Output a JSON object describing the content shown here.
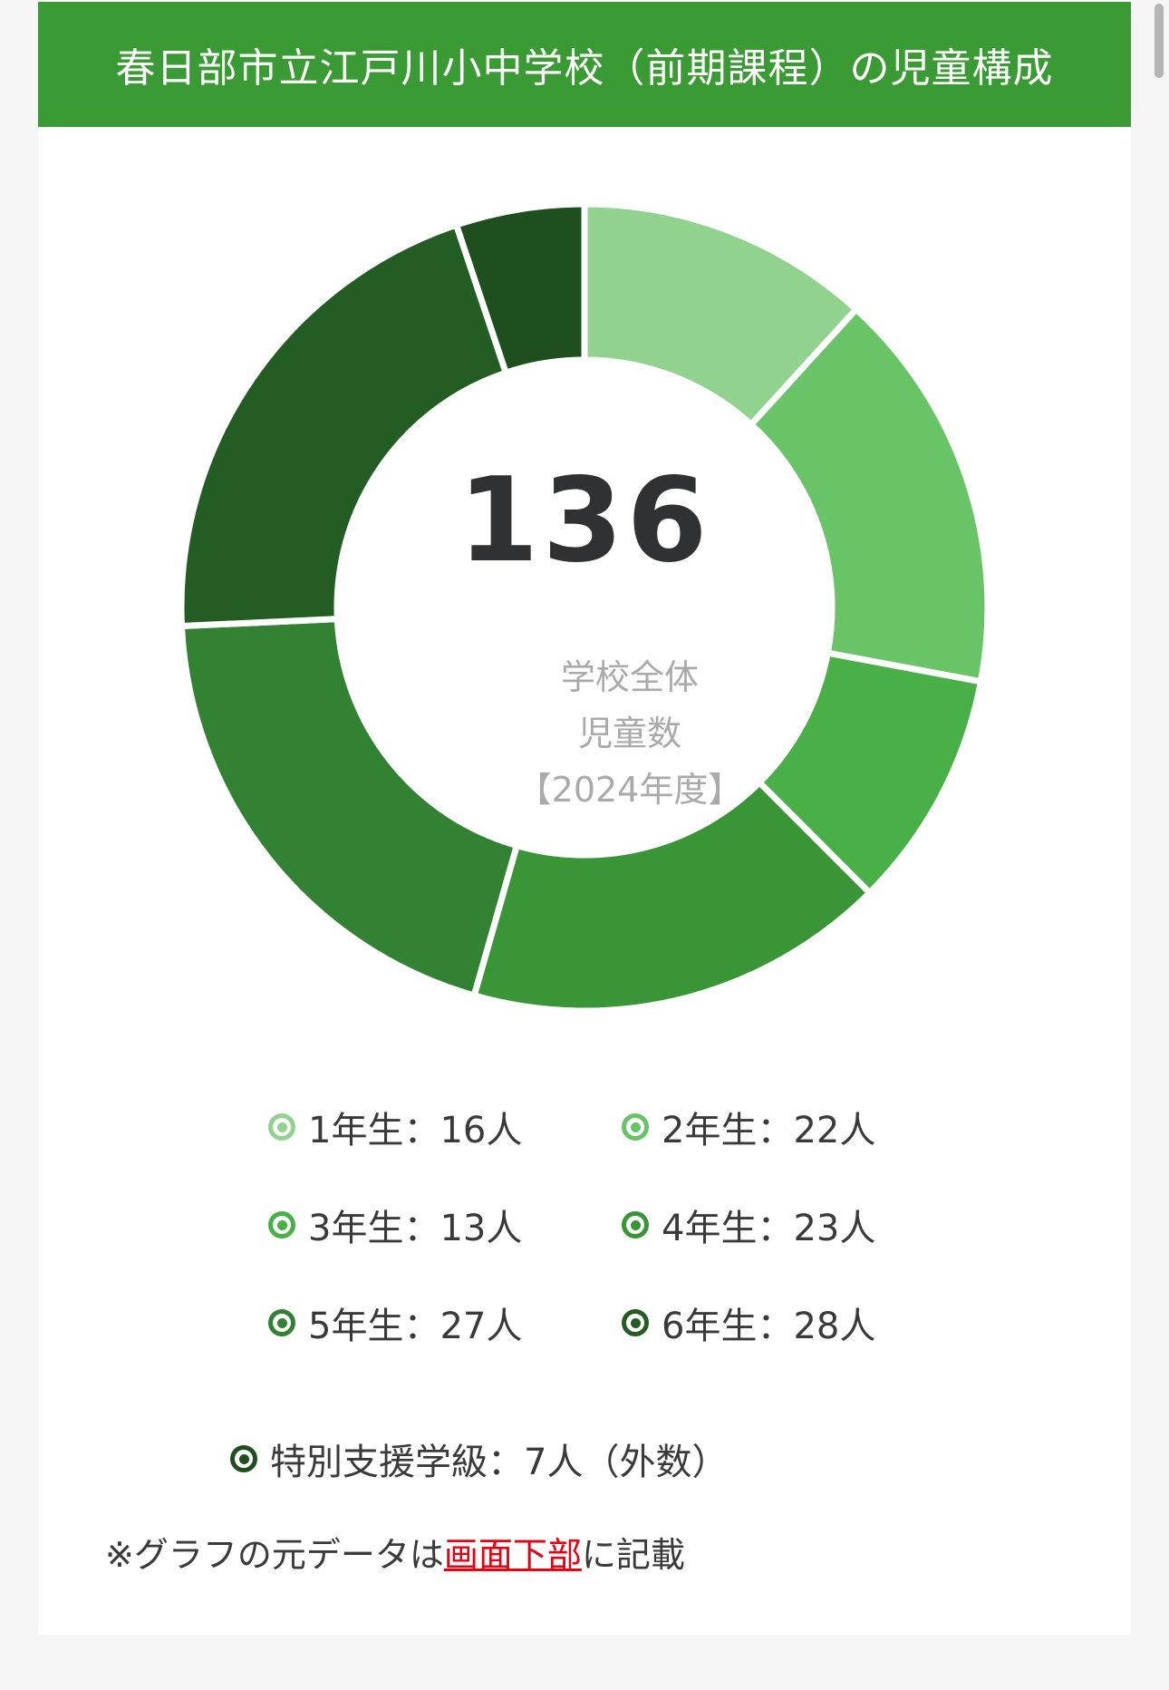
{
  "header": {
    "title": "春日部市立江戸川小中学校（前期課程）の児童構成"
  },
  "chart_data": {
    "type": "pie",
    "donut": true,
    "total": 136,
    "center_labels": [
      "学校全体",
      "児童数",
      "【2024年度】"
    ],
    "categories": [
      "1年生",
      "2年生",
      "3年生",
      "4年生",
      "5年生",
      "6年生",
      "特別支援学級"
    ],
    "values": [
      16,
      22,
      13,
      23,
      27,
      28,
      7
    ],
    "colors": [
      "#90d28e",
      "#68c466",
      "#48b046",
      "#3a9537",
      "#338234",
      "#245d23",
      "#1f4f1f"
    ]
  },
  "legend": [
    {
      "label": "1年生：16人",
      "color": "#90d28e"
    },
    {
      "label": "2年生：22人",
      "color": "#68c466"
    },
    {
      "label": "3年生：13人",
      "color": "#48b046"
    },
    {
      "label": "4年生：23人",
      "color": "#3a9537"
    },
    {
      "label": "5年生：27人",
      "color": "#338234"
    },
    {
      "label": "6年生：28人",
      "color": "#245d23"
    },
    {
      "label": "特別支援学級：7人（外数）",
      "color": "#1f4f1f"
    }
  ],
  "note": {
    "prefix": "※グラフの元データは",
    "link": "画面下部",
    "suffix": "に記載"
  }
}
